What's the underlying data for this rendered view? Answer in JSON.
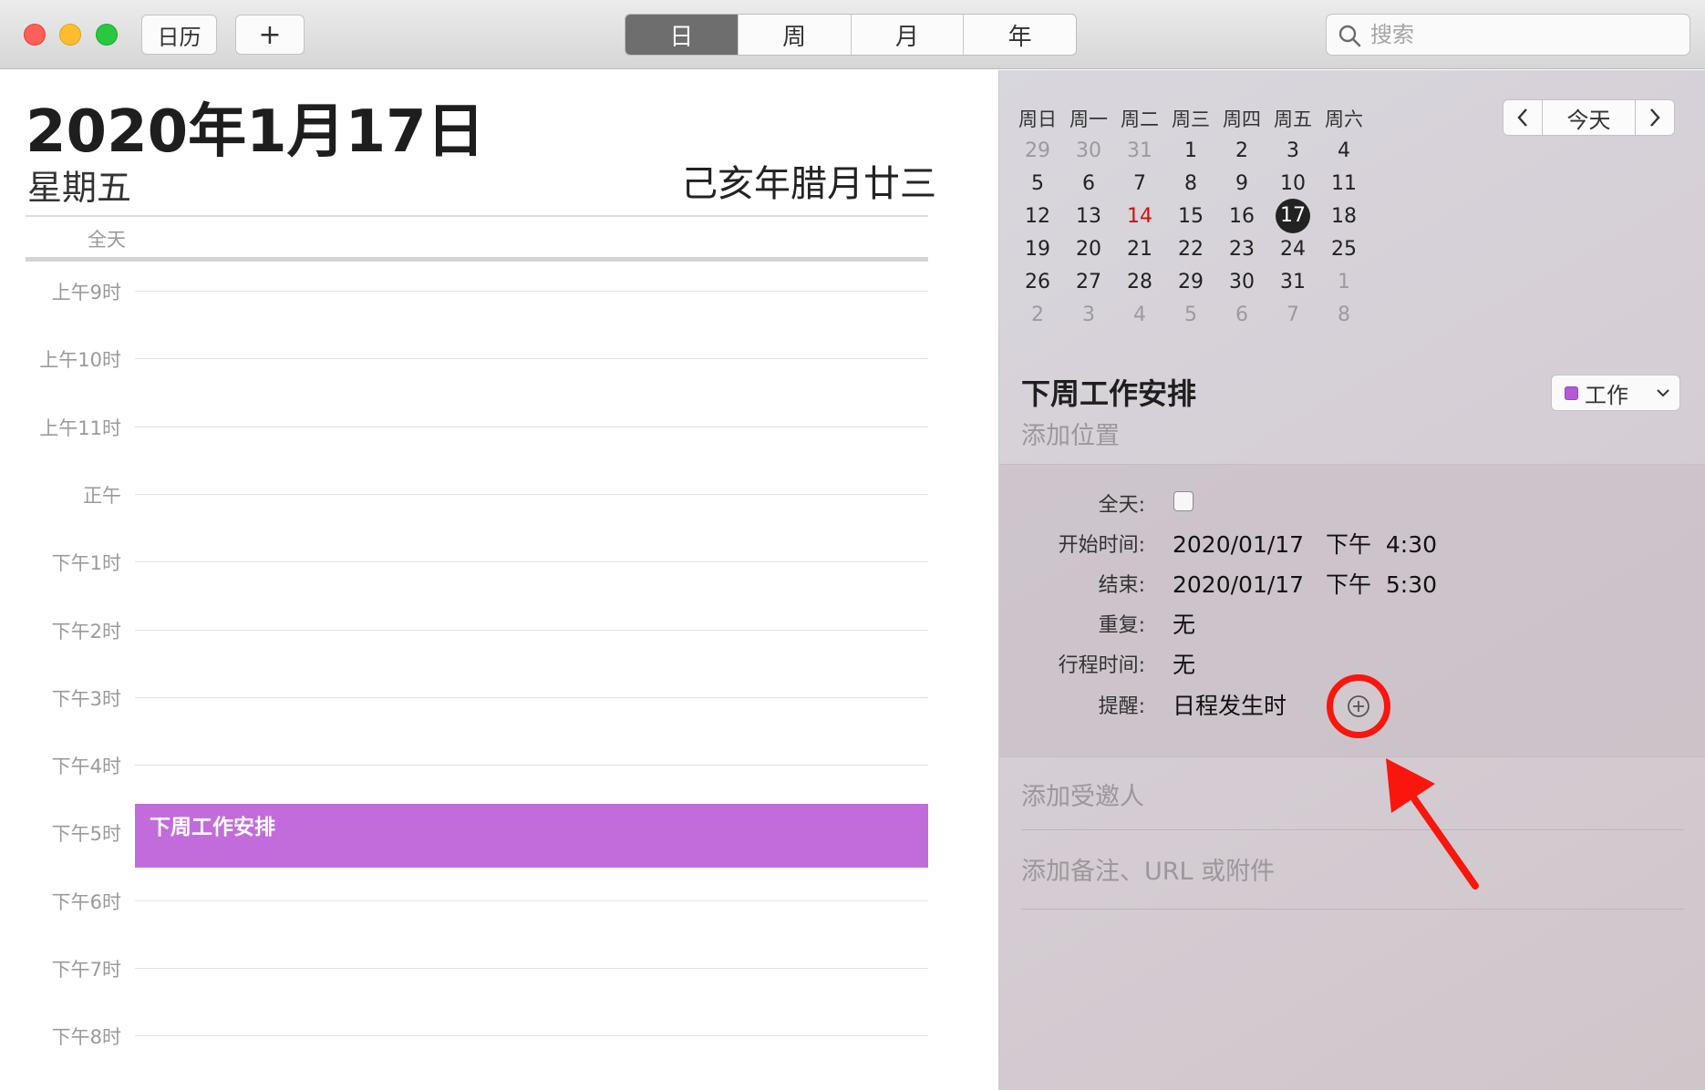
{
  "toolbar": {
    "calendars_label": "日历",
    "add_label": "+",
    "views": [
      {
        "label": "日",
        "active": true
      },
      {
        "label": "周",
        "active": false
      },
      {
        "label": "月",
        "active": false
      },
      {
        "label": "年",
        "active": false
      }
    ],
    "search_placeholder": "搜索"
  },
  "day_view": {
    "date_title": "2020年1月17日",
    "weekday": "星期五",
    "lunar_date": "己亥年腊月廿三",
    "allday_label": "全天",
    "hours": [
      "上午9时",
      "上午10时",
      "上午11时",
      "正午",
      "下午1时",
      "下午2时",
      "下午3时",
      "下午4时",
      "下午5时",
      "下午6时",
      "下午7时",
      "下午8时"
    ],
    "event": {
      "title": "下周工作安排",
      "color": "#c26cdc"
    }
  },
  "mini_calendar": {
    "weekdays": [
      "周日",
      "周一",
      "周二",
      "周三",
      "周四",
      "周五",
      "周六"
    ],
    "weeks": [
      [
        {
          "d": "29",
          "m": true
        },
        {
          "d": "30",
          "m": true
        },
        {
          "d": "31",
          "m": true
        },
        {
          "d": "1"
        },
        {
          "d": "2"
        },
        {
          "d": "3"
        },
        {
          "d": "4"
        }
      ],
      [
        {
          "d": "5"
        },
        {
          "d": "6"
        },
        {
          "d": "7"
        },
        {
          "d": "8"
        },
        {
          "d": "9"
        },
        {
          "d": "10"
        },
        {
          "d": "11"
        }
      ],
      [
        {
          "d": "12"
        },
        {
          "d": "13"
        },
        {
          "d": "14",
          "red": true
        },
        {
          "d": "15"
        },
        {
          "d": "16"
        },
        {
          "d": "17",
          "sel": true
        },
        {
          "d": "18"
        }
      ],
      [
        {
          "d": "19"
        },
        {
          "d": "20"
        },
        {
          "d": "21"
        },
        {
          "d": "22"
        },
        {
          "d": "23"
        },
        {
          "d": "24"
        },
        {
          "d": "25"
        }
      ],
      [
        {
          "d": "26"
        },
        {
          "d": "27"
        },
        {
          "d": "28"
        },
        {
          "d": "29"
        },
        {
          "d": "30"
        },
        {
          "d": "31"
        },
        {
          "d": "1",
          "m": true
        }
      ],
      [
        {
          "d": "2",
          "m": true
        },
        {
          "d": "3",
          "m": true
        },
        {
          "d": "4",
          "m": true
        },
        {
          "d": "5",
          "m": true
        },
        {
          "d": "6",
          "m": true
        },
        {
          "d": "7",
          "m": true
        },
        {
          "d": "8",
          "m": true
        }
      ]
    ],
    "today_label": "今天"
  },
  "inspector": {
    "event_title": "下周工作安排",
    "add_location": "添加位置",
    "calendar": {
      "name": "工作",
      "color": "#b55ad6"
    },
    "fields": {
      "allday_label": "全天:",
      "start_label": "开始时间:",
      "start_date": "2020/01/17",
      "start_ampm": "下午",
      "start_time": "4:30",
      "end_label": "结束:",
      "end_date": "2020/01/17",
      "end_ampm": "下午",
      "end_time": "5:30",
      "repeat_label": "重复:",
      "repeat_value": "无",
      "travel_label": "行程时间:",
      "travel_value": "无",
      "alert_label": "提醒:",
      "alert_value": "日程发生时"
    },
    "add_invitees": "添加受邀人",
    "add_notes": "添加备注、URL 或附件"
  },
  "annotation": {
    "highlight_color": "#f8160d"
  }
}
